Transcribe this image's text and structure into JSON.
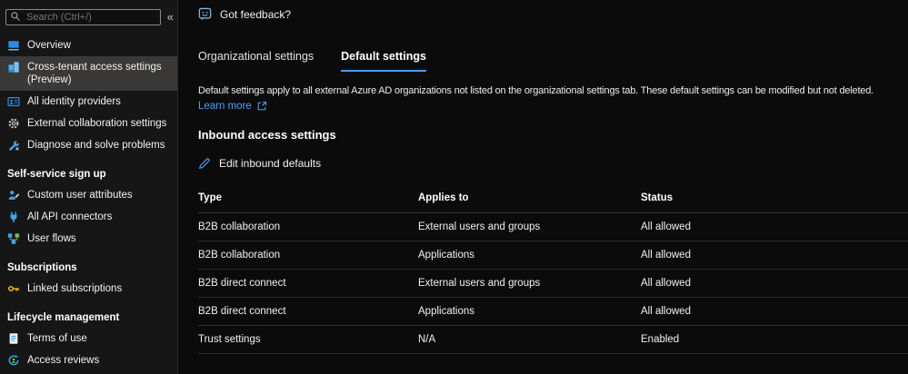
{
  "sidebar": {
    "search": {
      "placeholder": "Search (Ctrl+/)"
    },
    "collapse_glyph": "«",
    "sections": [
      {
        "header": "",
        "items": [
          {
            "label": "Overview"
          },
          {
            "label": "Cross-tenant access settings (Preview)"
          },
          {
            "label": "All identity providers"
          },
          {
            "label": "External collaboration settings"
          },
          {
            "label": "Diagnose and solve problems"
          }
        ]
      },
      {
        "header": "Self-service sign up",
        "items": [
          {
            "label": "Custom user attributes"
          },
          {
            "label": "All API connectors"
          },
          {
            "label": "User flows"
          }
        ]
      },
      {
        "header": "Subscriptions",
        "items": [
          {
            "label": "Linked subscriptions"
          }
        ]
      },
      {
        "header": "Lifecycle management",
        "items": [
          {
            "label": "Terms of use"
          },
          {
            "label": "Access reviews"
          }
        ]
      }
    ]
  },
  "header": {
    "feedback_label": "Got feedback?"
  },
  "tabs": [
    {
      "label": "Organizational settings",
      "active": false
    },
    {
      "label": "Default settings",
      "active": true
    }
  ],
  "main": {
    "description": "Default settings apply to all external Azure AD organizations not listed on the organizational settings tab. These default settings can be modified but not deleted.",
    "learn_more_label": "Learn more",
    "section_title": "Inbound access settings",
    "edit_button_label": "Edit inbound defaults",
    "table": {
      "columns": [
        "Type",
        "Applies to",
        "Status"
      ],
      "rows": [
        [
          "B2B collaboration",
          "External users and groups",
          "All allowed"
        ],
        [
          "B2B collaboration",
          "Applications",
          "All allowed"
        ],
        [
          "B2B direct connect",
          "External users and groups",
          "All allowed"
        ],
        [
          "B2B direct connect",
          "Applications",
          "All allowed"
        ],
        [
          "Trust settings",
          "N/A",
          "Enabled"
        ]
      ]
    }
  },
  "colors": {
    "accent": "#479ef5",
    "link": "#4ea1f0",
    "selected_item_bg": "#3a3938",
    "key_icon_yellow": "#e9b117"
  }
}
